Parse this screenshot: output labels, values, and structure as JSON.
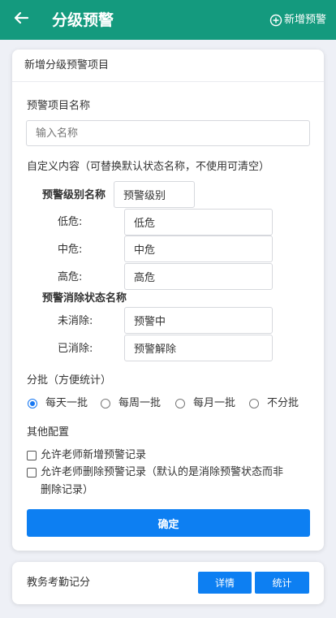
{
  "header": {
    "title": "分级预警",
    "add_label": "新增预警",
    "bg_color": "#149a7e"
  },
  "form": {
    "card_title": "新增分级预警项目",
    "name_label": "预警项目名称",
    "name_placeholder": "输入名称",
    "name_value": "",
    "custom_label": "自定义内容（可替换默认状态名称，不使用可清空）",
    "level_section_label": "预警级别名称",
    "level_section_value": "预警级别",
    "levels": [
      {
        "label": "低危:",
        "value": "低危"
      },
      {
        "label": "中危:",
        "value": "中危"
      },
      {
        "label": "高危:",
        "value": "高危"
      }
    ],
    "clear_section_label": "预警消除状态名称",
    "clear_states": [
      {
        "label": "未消除:",
        "value": "预警中"
      },
      {
        "label": "已消除:",
        "value": "预警解除"
      }
    ],
    "batch_label": "分批（方便统计）",
    "batch_options": [
      "每天一批",
      "每周一批",
      "每月一批",
      "不分批"
    ],
    "batch_selected": "每天一批",
    "other_label": "其他配置",
    "checkbox_add": "允许老师新增预警记录",
    "checkbox_delete_line1": "允许老师删除预警记录（默认的是消除预警状态而非",
    "checkbox_delete_line2": "删除记录）",
    "confirm_label": "确定"
  },
  "bottom_card": {
    "label": "教务考勤记分",
    "detail_button": "详情",
    "stats_button": "统计"
  },
  "colors": {
    "primary": "#0d7ff2",
    "header": "#149a7e"
  }
}
